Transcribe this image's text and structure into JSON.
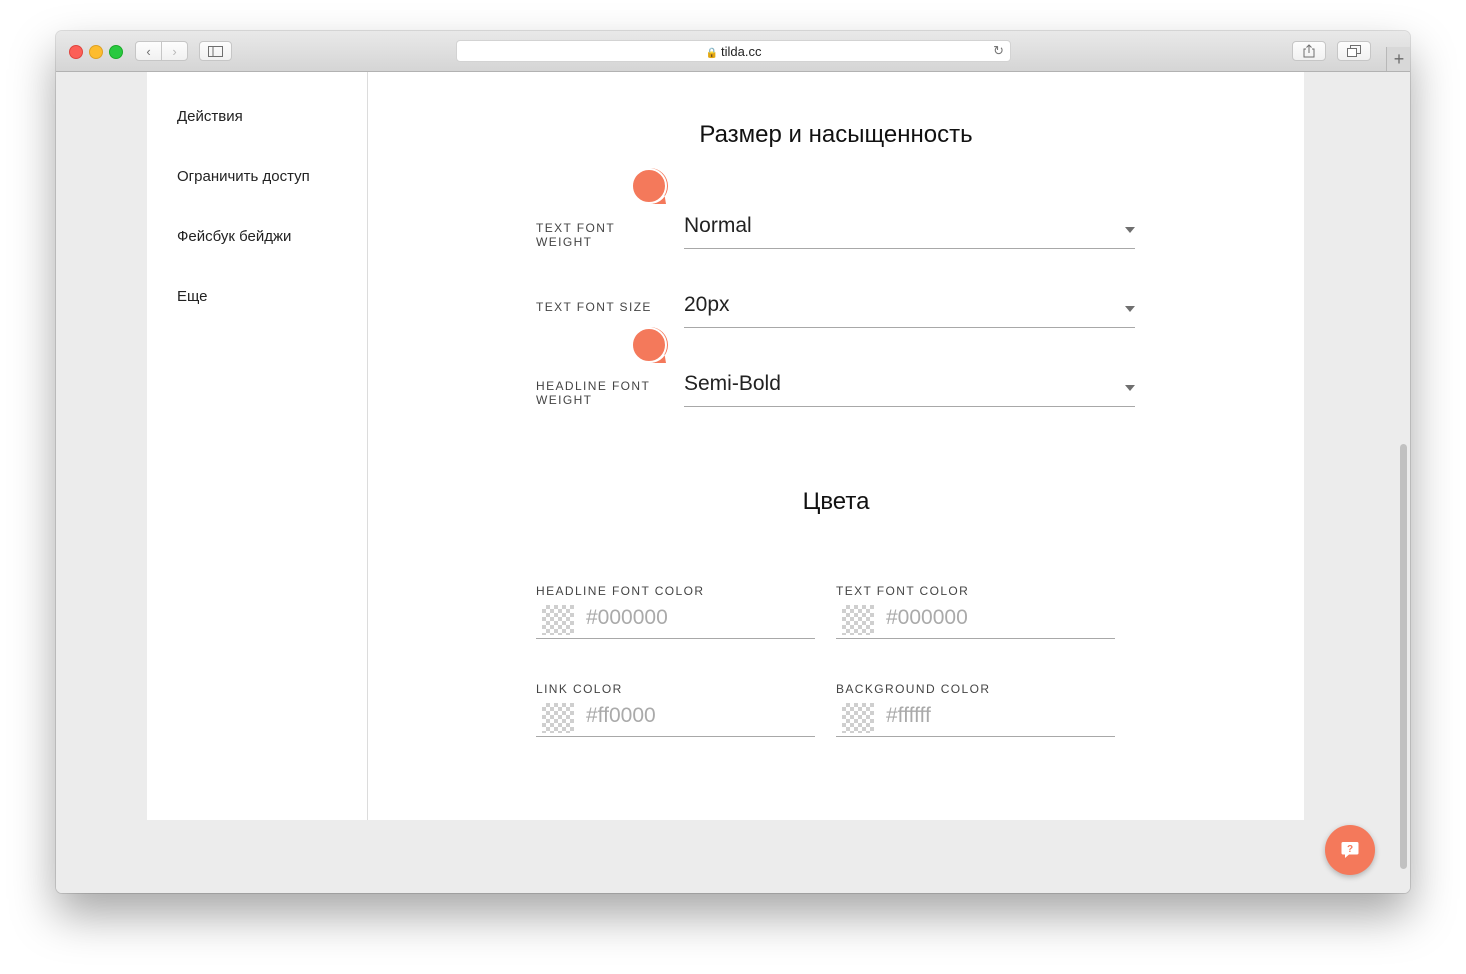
{
  "browser": {
    "url": "tilda.cc",
    "back_glyph": "‹",
    "forward_glyph": "›",
    "newtab_glyph": "+",
    "reload_glyph": "↻",
    "lock_glyph": "🔒"
  },
  "sidebar": {
    "items": [
      {
        "label": "Действия"
      },
      {
        "label": "Ограничить доступ"
      },
      {
        "label": "Фейсбук бейджи"
      },
      {
        "label": "Еще"
      }
    ]
  },
  "typography": {
    "title": "Размер и насыщенность",
    "text_font_weight": {
      "label_line1": "TEXT FONT",
      "label_line2": "WEIGHT",
      "value": "Normal"
    },
    "text_font_size": {
      "label": "TEXT FONT SIZE",
      "value": "20px"
    },
    "headline_font_weight": {
      "label_line1": "HEADLINE FONT",
      "label_line2": "WEIGHT",
      "value": "Semi-Bold"
    }
  },
  "colors": {
    "title": "Цвета",
    "headline_font_color": {
      "label": "HEADLINE FONT COLOR",
      "placeholder": "#000000"
    },
    "text_font_color": {
      "label": "TEXT FONT COLOR",
      "placeholder": "#000000"
    },
    "link_color": {
      "label": "LINK COLOR",
      "placeholder": "#ff0000"
    },
    "background_color": {
      "label": "BACKGROUND COLOR",
      "placeholder": "#ffffff"
    }
  },
  "theme": {
    "accent": "#f4795b",
    "icons": [
      "lock-icon",
      "reload-icon",
      "share-icon",
      "tabs-icon",
      "caret-icon",
      "marker-icon",
      "help-icon"
    ]
  }
}
